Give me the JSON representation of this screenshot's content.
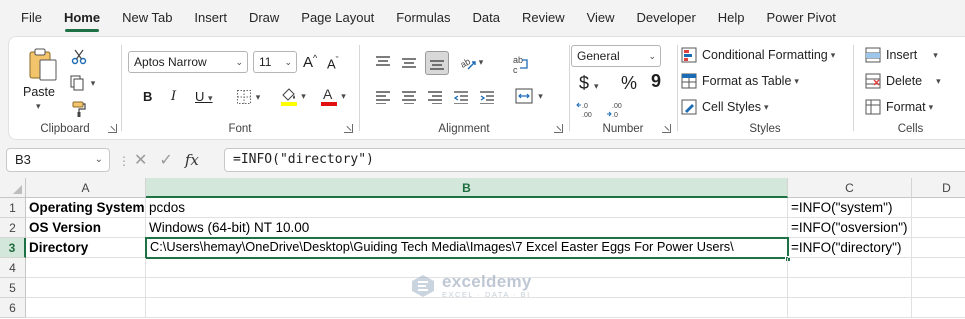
{
  "menu": {
    "tabs": [
      {
        "label": "File"
      },
      {
        "label": "Home"
      },
      {
        "label": "New Tab"
      },
      {
        "label": "Insert"
      },
      {
        "label": "Draw"
      },
      {
        "label": "Page Layout"
      },
      {
        "label": "Formulas"
      },
      {
        "label": "Data"
      },
      {
        "label": "Review"
      },
      {
        "label": "View"
      },
      {
        "label": "Developer"
      },
      {
        "label": "Help"
      },
      {
        "label": "Power Pivot"
      }
    ],
    "active": "Home"
  },
  "ribbon": {
    "clipboard": {
      "label": "Clipboard",
      "paste": "Paste"
    },
    "font": {
      "label": "Font",
      "font_name": "Aptos Narrow",
      "font_size": "11",
      "bold": "B",
      "italic": "I",
      "underline": "U",
      "grow": "A",
      "shrink": "A"
    },
    "alignment": {
      "label": "Alignment"
    },
    "number": {
      "label": "Number",
      "format": "General",
      "currency": "$",
      "percent": "%",
      "comma": "9"
    },
    "styles": {
      "label": "Styles",
      "conditional": "Conditional Formatting",
      "table": "Format as Table",
      "cell_styles": "Cell Styles"
    },
    "cells": {
      "label": "Cells",
      "insert": "Insert",
      "delete": "Delete",
      "format": "Format"
    }
  },
  "formula_bar": {
    "name_box": "B3",
    "fx": "fx",
    "formula": "=INFO(\"directory\")"
  },
  "grid": {
    "columns": [
      "A",
      "B",
      "C",
      "D"
    ],
    "rows": [
      "1",
      "2",
      "3",
      "4",
      "5",
      "6"
    ],
    "cells": {
      "A1": "Operating System",
      "B1": "pcdos",
      "C1": "=INFO(\"system\")",
      "A2": "OS Version",
      "B2": "Windows (64-bit) NT 10.00",
      "C2": "=INFO(\"osversion\")",
      "A3": "Directory",
      "B3": "C:\\Users\\hemay\\OneDrive\\Desktop\\Guiding Tech Media\\Images\\7 Excel Easter Eggs For Power Users\\",
      "C3": "=INFO(\"directory\")"
    }
  },
  "watermark": {
    "title": "exceldemy",
    "subtitle": "EXCEL · DATA · BI"
  },
  "colors": {
    "accent": "#1e7145",
    "ribbon_bg": "#ffffff",
    "app_bg": "#f3f3f3"
  }
}
